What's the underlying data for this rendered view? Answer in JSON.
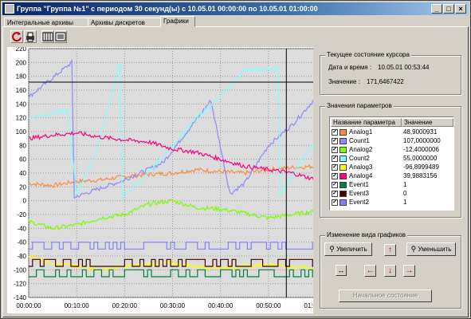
{
  "window": {
    "title": "Группа \"Группа №1\" с периодом 30 секунд(ы) с 10.05.01 00:00:00 по 10.05.01 01:00:00",
    "controls": [
      "_",
      "□",
      "×"
    ]
  },
  "tabs": [
    {
      "label": "Интегральные архивы"
    },
    {
      "label": "Архивы дискретов"
    },
    {
      "label": "Графики"
    }
  ],
  "toolbar": {
    "icons": [
      "refresh-icon",
      "print-icon",
      "grid-view-icon",
      "list-view-icon"
    ]
  },
  "cursor_state": {
    "title": "Текущее состояние курсора",
    "datetime_label": "Дата и время :",
    "datetime_value": "10.05.01 00:53:44",
    "value_label": "Значение :",
    "value_value": "171,6467422"
  },
  "parameters": {
    "title": "Значения параметров",
    "col_name": "Название параметра",
    "col_value": "Значение",
    "rows": [
      {
        "name": "Analog1",
        "value": "48,9000931",
        "color": "#ff8c3c",
        "checked": true
      },
      {
        "name": "Count1",
        "value": "107,0000000",
        "color": "#8c8cff",
        "checked": true
      },
      {
        "name": "Analog2",
        "value": "-12,4000006",
        "color": "#7cff00",
        "checked": true
      },
      {
        "name": "Count2",
        "value": "55,0000000",
        "color": "#80ffff",
        "checked": true
      },
      {
        "name": "Analog3",
        "value": "-96,8999489",
        "color": "#ffff00",
        "checked": true
      },
      {
        "name": "Analog4",
        "value": "39,9883156",
        "color": "#ff0080",
        "checked": true
      },
      {
        "name": "Event1",
        "value": "1",
        "color": "#008040",
        "checked": true
      },
      {
        "name": "Event3",
        "value": "0",
        "color": "#400000",
        "checked": true
      },
      {
        "name": "Event2",
        "value": "1",
        "color": "#8080ff",
        "checked": true
      }
    ]
  },
  "view_controls": {
    "title": "Изменение вида графиков",
    "zoom_in": "Увеличить",
    "zoom_out": "Уменьшить",
    "reset": "Начальное состояние"
  },
  "chart_data": {
    "type": "line",
    "title": "",
    "xlabel": "",
    "ylabel": "",
    "ylim": [
      -140,
      220
    ],
    "yticks": [
      220,
      200,
      180,
      160,
      140,
      120,
      100,
      80,
      60,
      40,
      20,
      0,
      -20,
      -40,
      -60,
      -80,
      -100,
      -120,
      -140
    ],
    "xlim": [
      "00:00:00",
      "01:00:00"
    ],
    "xticks": [
      "00:00:00",
      "00:10:00",
      "00:20:00",
      "00:30:00",
      "00:40:00",
      "00:50:00",
      "01:00:00"
    ],
    "grid": true,
    "cursor_x": "00:53:44",
    "series": [
      {
        "name": "Analog1",
        "color": "#ff8c3c",
        "x": [
          0,
          5,
          10,
          15,
          20,
          25,
          30,
          35,
          40,
          45,
          50,
          55,
          60
        ],
        "y": [
          25,
          22,
          28,
          30,
          35,
          38,
          40,
          45,
          42,
          40,
          45,
          48,
          50
        ]
      },
      {
        "name": "Count1",
        "color": "#8c8cff",
        "x": [
          0,
          9,
          9.5,
          20,
          28,
          38,
          42,
          45,
          50,
          55,
          60
        ],
        "y": [
          150,
          200,
          5,
          30,
          55,
          145,
          10,
          25,
          80,
          110,
          150
        ]
      },
      {
        "name": "Analog2",
        "color": "#7cff00",
        "x": [
          0,
          5,
          10,
          15,
          20,
          25,
          30,
          35,
          40,
          45,
          50,
          55,
          60
        ],
        "y": [
          -30,
          -40,
          -35,
          -25,
          -20,
          -5,
          0,
          -10,
          -12,
          -18,
          -25,
          -20,
          -15
        ]
      },
      {
        "name": "Count2",
        "color": "#80ffff",
        "x": [
          0,
          8,
          10,
          14,
          19,
          19.5,
          25,
          30,
          35,
          40,
          45,
          52,
          52.5,
          60
        ],
        "y": [
          120,
          130,
          10,
          70,
          200,
          5,
          40,
          80,
          120,
          150,
          190,
          190,
          10,
          90
        ]
      },
      {
        "name": "Analog3",
        "color": "#ffff00",
        "x": [
          0,
          5,
          10,
          15,
          20,
          25,
          30,
          35,
          40,
          45,
          50,
          55,
          60
        ],
        "y": [
          -80,
          -90,
          -95,
          -100,
          -95,
          -92,
          -90,
          -95,
          -97,
          -95,
          -92,
          -96,
          -97
        ]
      },
      {
        "name": "Analog4",
        "color": "#ff0080",
        "x": [
          0,
          5,
          10,
          15,
          20,
          25,
          30,
          35,
          40,
          45,
          50,
          55,
          60
        ],
        "y": [
          90,
          95,
          98,
          92,
          88,
          85,
          75,
          70,
          60,
          50,
          45,
          40,
          30
        ]
      },
      {
        "name": "Event1",
        "color": "#008040",
        "pattern": "square",
        "low": -110,
        "high": -100
      },
      {
        "name": "Event3",
        "color": "#400000",
        "pattern": "square",
        "low": -95,
        "high": -85
      },
      {
        "name": "Event2",
        "color": "#8080ff",
        "pattern": "square",
        "low": -70,
        "high": -60
      }
    ]
  }
}
